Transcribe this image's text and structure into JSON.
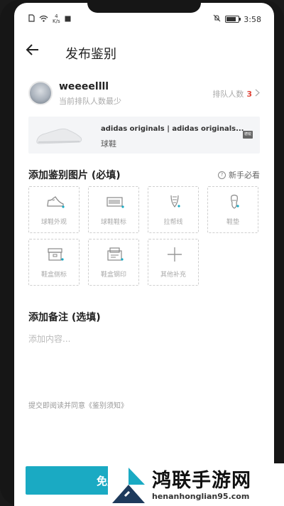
{
  "status_bar": {
    "speed_top": "4",
    "speed_unit": "K/s",
    "time": "3:58",
    "battery_level": 0.8
  },
  "nav": {
    "title": "发布鉴别"
  },
  "user": {
    "name": "weeeellll",
    "subtitle": "当前排队人数最少",
    "queue_label": "排队人数",
    "queue_count": "3"
  },
  "product": {
    "brand": "adidas originals | adidas originals...",
    "category": "球鞋",
    "tag": "德锐"
  },
  "photos": {
    "title": "添加鉴别图片 (必填)",
    "help": "新手必看",
    "tiles": [
      {
        "label": "球鞋外观",
        "icon": "sneaker-icon"
      },
      {
        "label": "球鞋鞋标",
        "icon": "barcode-label-icon"
      },
      {
        "label": "拉帮线",
        "icon": "stitch-line-icon"
      },
      {
        "label": "鞋垫",
        "icon": "insole-icon"
      },
      {
        "label": "鞋盒侧标",
        "icon": "shoebox-side-icon"
      },
      {
        "label": "鞋盒钢印",
        "icon": "shoebox-stamp-icon"
      },
      {
        "label": "其他补充",
        "icon": "plus-icon"
      }
    ]
  },
  "remark": {
    "title": "添加备注 (选填)",
    "placeholder": "添加内容..."
  },
  "agreement": "提交即阅读并同意《鉴别须知》",
  "submit": {
    "label": "免费"
  },
  "watermark": {
    "title": "鸿联手游网",
    "url": "henanhonglian95.com"
  },
  "colors": {
    "accent": "#1aaac3",
    "queue_count": "#e0463a"
  }
}
